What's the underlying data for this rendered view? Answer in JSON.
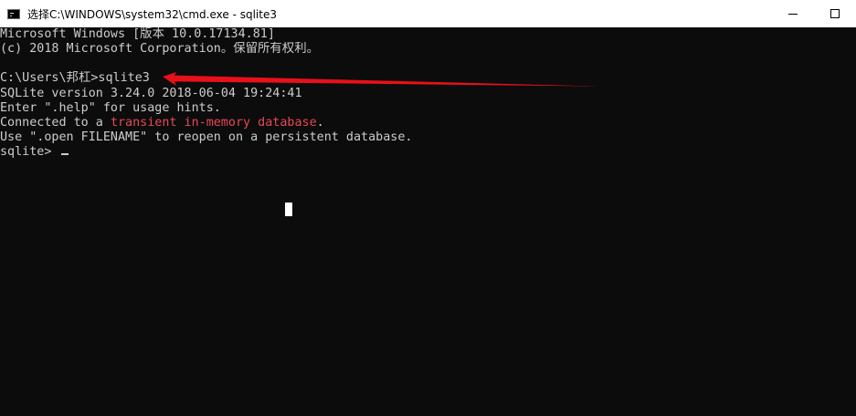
{
  "window": {
    "title": "选择C:\\WINDOWS\\system32\\cmd.exe - sqlite3",
    "icon": "console-app-icon",
    "controls": [
      "minimize-icon",
      "maximize-icon"
    ]
  },
  "console": {
    "lines": [
      {
        "text": "Microsoft Windows [版本 10.0.17134.81]"
      },
      {
        "text": "(c) 2018 Microsoft Corporation。保留所有权利。"
      },
      {
        "text": ""
      },
      {
        "text": "C:\\Users\\邦杠>sqlite3"
      },
      {
        "text": "SQLite version 3.24.0 2018-06-04 19:24:41"
      },
      {
        "text": "Enter \".help\" for usage hints."
      },
      {
        "pre": "Connected to a ",
        "red": "transient in-memory database",
        "post": "."
      },
      {
        "text": "Use \".open FILENAME\" to reopen on a persistent database."
      },
      {
        "text": "sqlite> "
      }
    ]
  },
  "colors": {
    "background": "#0c0c0c",
    "text": "#cccccc",
    "highlight": "#e74856",
    "annotation_arrow": "#e8101a"
  }
}
